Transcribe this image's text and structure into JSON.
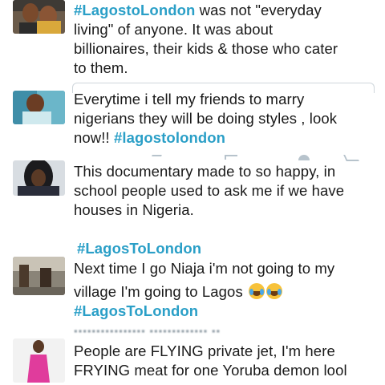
{
  "tweets": [
    {
      "avatar": "profile-photo",
      "lines": [
        {
          "hashtag": "#LagostoLondon",
          "text": " was not \"everyday"
        },
        {
          "text": "living\" of anyone. It was about"
        },
        {
          "text": "billionaires, their kids & those who cater"
        },
        {
          "text": "to them."
        }
      ]
    },
    {
      "avatar": "profile-photo",
      "lines": [
        {
          "text": "Everytime i tell my friends to marry"
        },
        {
          "text": "nigerians they will be doing styles , look"
        },
        {
          "text": "now!! ",
          "hashtag": "#lagostolondon"
        }
      ]
    },
    {
      "avatar": "profile-photo",
      "lines": [
        {
          "text": "This documentary made to so happy, in"
        },
        {
          "text": "school people used to ask me if we have"
        },
        {
          "text": "houses in Nigeria."
        }
      ],
      "footer_hashtag": "#LagosToLondon"
    },
    {
      "avatar": "profile-photo",
      "lines": [
        {
          "text": "Next time I go Niaja i'm not going to my"
        },
        {
          "text": "village I'm going to Lagos "
        },
        {
          "hashtag": "#LagosToLondon"
        }
      ],
      "emojis": [
        "joy-emoji",
        "joy-emoji"
      ]
    },
    {
      "avatar": "profile-photo",
      "lines": [
        {
          "text": "People are FLYING private jet, I'm here"
        },
        {
          "text": "FRYING meat for one Yoruba demon lool"
        }
      ]
    }
  ],
  "action_icons": [
    "reply-icon",
    "retweet-icon",
    "like-icon",
    "more-icon"
  ],
  "colors": {
    "hashtag": "#2a9fc7",
    "text": "#1a1a1a",
    "icon": "#b7c3cc"
  }
}
